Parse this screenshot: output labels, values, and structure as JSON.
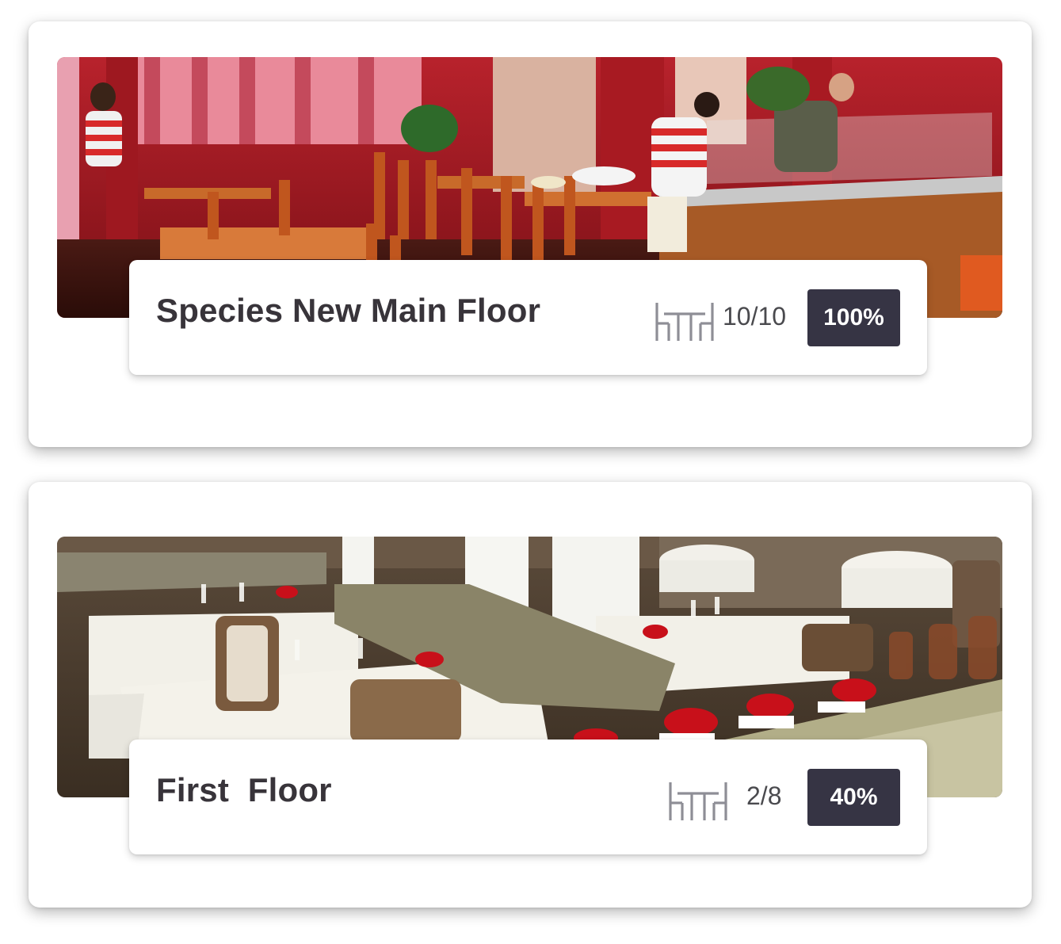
{
  "floors": [
    {
      "name": "Species New Main Floor",
      "tables": "10/10",
      "occupancy": "100%",
      "occupancy_fraction": 1.0,
      "photo": "restaurant-photo-red-dining-room",
      "icon": "table-chairs-icon"
    },
    {
      "name": "First  Floor",
      "tables": "2/8",
      "occupancy": "40%",
      "occupancy_fraction": 0.4,
      "photo": "restaurant-photo-white-tablecloth-dining-room",
      "icon": "table-chairs-icon"
    }
  ],
  "colors": {
    "badge_bg": "#363444",
    "title_text": "#38343a",
    "icon_gray": "#8e8e96"
  }
}
